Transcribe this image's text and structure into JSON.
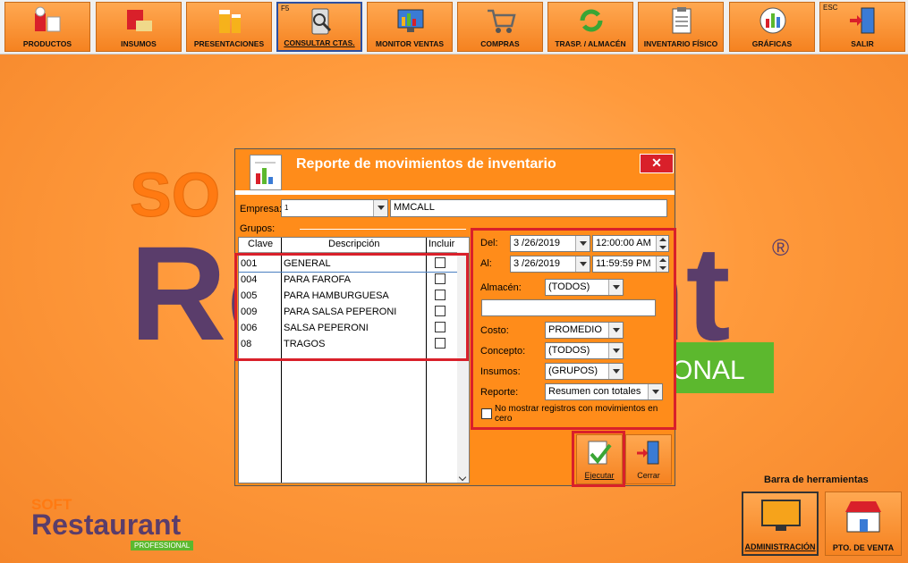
{
  "toolbar": {
    "buttons": [
      {
        "label": "PRODUCTOS",
        "icon": "products-icon"
      },
      {
        "label": "INSUMOS",
        "icon": "supplies-icon"
      },
      {
        "label": "PRESENTACIONES",
        "icon": "beer-icon"
      },
      {
        "label": "CONSULTAR CTAS.",
        "hotkey": "F5",
        "icon": "search-phone-icon"
      },
      {
        "label": "MONITOR VENTAS",
        "icon": "monitor-icon"
      },
      {
        "label": "COMPRAS",
        "icon": "cart-icon"
      },
      {
        "label": "TRASP. / ALMACÉN",
        "icon": "transfer-icon"
      },
      {
        "label": "INVENTARIO FÍSICO",
        "icon": "clipboard-icon"
      },
      {
        "label": "GRÁFICAS",
        "icon": "chart-icon"
      },
      {
        "label": "SALIR",
        "hotkey": "ESC",
        "icon": "exit-door-icon"
      }
    ]
  },
  "dialog": {
    "title": "Reporte de movimientos de inventario",
    "close": "✕",
    "empresa_label": "Empresa:",
    "empresa_code": "1",
    "empresa_name": "MMCALL",
    "grupos_label": "Grupos:",
    "grid": {
      "headers": [
        "Clave",
        "Descripción",
        "Incluir"
      ],
      "rows": [
        {
          "clave": "001",
          "descripcion": "GENERAL"
        },
        {
          "clave": "004",
          "descripcion": "PARA FAROFA"
        },
        {
          "clave": "005",
          "descripcion": "PARA HAMBURGUESA"
        },
        {
          "clave": "009",
          "descripcion": "PARA SALSA PEPERONI"
        },
        {
          "clave": "006",
          "descripcion": "SALSA PEPERONI"
        },
        {
          "clave": "08",
          "descripcion": "TRAGOS"
        }
      ]
    },
    "del_label": "Del:",
    "del_date": "3 /26/2019",
    "del_time": "12:00:00 AM",
    "al_label": "Al:",
    "al_date": "3 /26/2019",
    "al_time": "11:59:59 PM",
    "almacen_label": "Almacén:",
    "almacen_value": "(TODOS)",
    "costo_label": "Costo:",
    "costo_value": "PROMEDIO",
    "concepto_label": "Concepto:",
    "concepto_value": "(TODOS)",
    "insumos_label": "Insumos:",
    "insumos_value": "(GRUPOS)",
    "reporte_label": "Reporte:",
    "reporte_value": "Resumen con totales",
    "no_mostrar_label": "No mostrar registros con movimientos en cero",
    "ejecutar_label": "Ejecutar",
    "cerrar_label": "Cerrar"
  },
  "bottom": {
    "title": "Barra de herramientas",
    "admin_label": "ADMINISTRACIÓN",
    "pos_label": "PTO. DE VENTA"
  },
  "background_logo": {
    "soft": "SOFT",
    "restaurant": "Restaurant",
    "professional": "PROFESSIONAL"
  },
  "colors": {
    "accent": "#ff8c1a",
    "highlight": "#d9202a",
    "brand_purple": "#5a3d6b",
    "brand_green": "#5cb82e"
  }
}
